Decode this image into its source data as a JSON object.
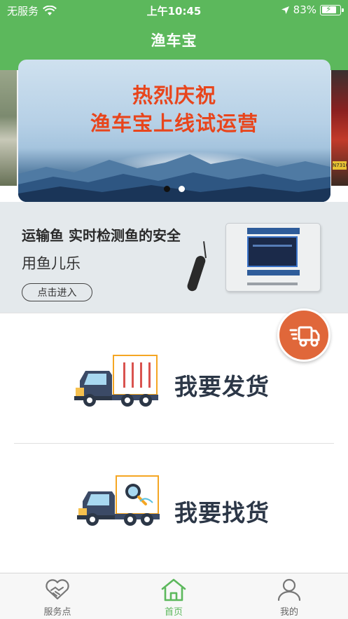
{
  "status_bar": {
    "carrier": "无服务",
    "time": "上午10:45",
    "battery": "83%"
  },
  "nav": {
    "title": "渔车宝"
  },
  "banner": {
    "line1": "热烈庆祝",
    "line2": "渔车宝上线试运营",
    "side_plate": "N7310",
    "page_count": 2,
    "active_page": 1
  },
  "promo": {
    "title": "运输鱼 实时检测鱼的安全",
    "subtitle": "用鱼儿乐",
    "enter_label": "点击进入"
  },
  "menu": {
    "ship_label": "我要发货",
    "find_label": "我要找货"
  },
  "tabs": [
    {
      "label": "服务点",
      "icon": "handshake-heart-icon",
      "active": false
    },
    {
      "label": "首页",
      "icon": "home-icon",
      "active": true
    },
    {
      "label": "我的",
      "icon": "user-icon",
      "active": false
    }
  ],
  "colors": {
    "brand_green": "#5cb85c",
    "banner_text": "#e8451c",
    "float_orange": "#e0673a",
    "menu_text": "#2c3747"
  }
}
